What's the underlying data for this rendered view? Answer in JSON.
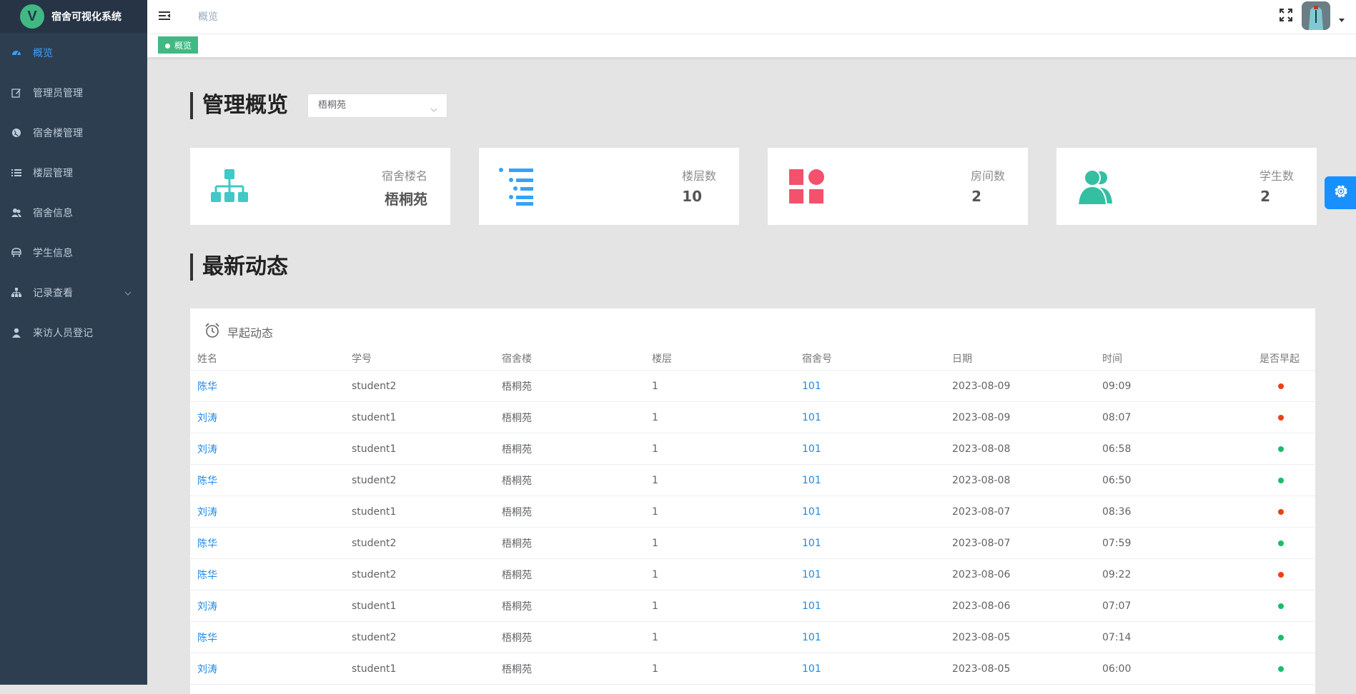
{
  "app": {
    "title": "宿舍可视化系统",
    "logo_letter": "V"
  },
  "sidebar": {
    "items": [
      {
        "label": "概览",
        "icon": "dashboard-icon",
        "active": true
      },
      {
        "label": "管理员管理",
        "icon": "edit-icon"
      },
      {
        "label": "宿舍楼管理",
        "icon": "globe-icon"
      },
      {
        "label": "楼层管理",
        "icon": "list-icon"
      },
      {
        "label": "宿舍信息",
        "icon": "users-icon"
      },
      {
        "label": "学生信息",
        "icon": "student-icon"
      },
      {
        "label": "记录查看",
        "icon": "tree-icon",
        "has_children": true
      },
      {
        "label": "来访人员登记",
        "icon": "user-icon"
      }
    ]
  },
  "header": {
    "breadcrumb": "概览"
  },
  "tags": [
    {
      "label": "概览",
      "active": true
    }
  ],
  "overview": {
    "title": "管理概览",
    "select_value": "梧桐苑",
    "cards": [
      {
        "label": "宿舍楼名",
        "value": "梧桐苑",
        "icon": "org-chart-icon",
        "color": "#40c9c6"
      },
      {
        "label": "楼层数",
        "value": "10",
        "icon": "list-icon",
        "color": "#36a3f7"
      },
      {
        "label": "房间数",
        "value": "2",
        "icon": "shapes-icon",
        "color": "#f4516c"
      },
      {
        "label": "学生数",
        "value": "2",
        "icon": "people-icon",
        "color": "#34bfa3"
      }
    ]
  },
  "activity": {
    "title": "最新动态",
    "panel_title": "早起动态",
    "columns": [
      "姓名",
      "学号",
      "宿舍楼",
      "楼层",
      "宿舍号",
      "日期",
      "时间",
      "是否早起"
    ],
    "rows": [
      {
        "name": "陈华",
        "sid": "student2",
        "building": "梧桐苑",
        "floor": "1",
        "room": "101",
        "date": "2023-08-09",
        "time": "09:09",
        "early": false
      },
      {
        "name": "刘涛",
        "sid": "student1",
        "building": "梧桐苑",
        "floor": "1",
        "room": "101",
        "date": "2023-08-09",
        "time": "08:07",
        "early": false
      },
      {
        "name": "刘涛",
        "sid": "student1",
        "building": "梧桐苑",
        "floor": "1",
        "room": "101",
        "date": "2023-08-08",
        "time": "06:58",
        "early": true
      },
      {
        "name": "陈华",
        "sid": "student2",
        "building": "梧桐苑",
        "floor": "1",
        "room": "101",
        "date": "2023-08-08",
        "time": "06:50",
        "early": true
      },
      {
        "name": "刘涛",
        "sid": "student1",
        "building": "梧桐苑",
        "floor": "1",
        "room": "101",
        "date": "2023-08-07",
        "time": "08:36",
        "early": false
      },
      {
        "name": "陈华",
        "sid": "student2",
        "building": "梧桐苑",
        "floor": "1",
        "room": "101",
        "date": "2023-08-07",
        "time": "07:59",
        "early": true
      },
      {
        "name": "陈华",
        "sid": "student2",
        "building": "梧桐苑",
        "floor": "1",
        "room": "101",
        "date": "2023-08-06",
        "time": "09:22",
        "early": false
      },
      {
        "name": "刘涛",
        "sid": "student1",
        "building": "梧桐苑",
        "floor": "1",
        "room": "101",
        "date": "2023-08-06",
        "time": "07:07",
        "early": true
      },
      {
        "name": "陈华",
        "sid": "student2",
        "building": "梧桐苑",
        "floor": "1",
        "room": "101",
        "date": "2023-08-05",
        "time": "07:14",
        "early": true
      },
      {
        "name": "刘涛",
        "sid": "student1",
        "building": "梧桐苑",
        "floor": "1",
        "room": "101",
        "date": "2023-08-05",
        "time": "06:00",
        "early": true
      }
    ]
  },
  "colors": {
    "early_yes": "#19be6b",
    "early_no": "#ed3f14",
    "accent": "#409eff",
    "brand": "#42b983"
  }
}
